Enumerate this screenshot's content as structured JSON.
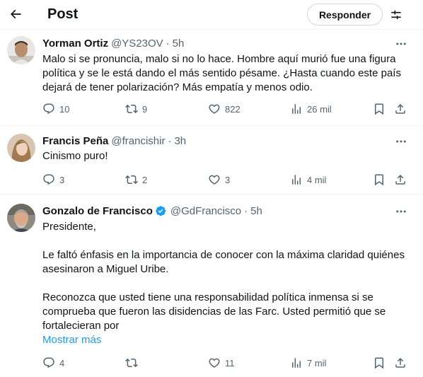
{
  "header": {
    "title": "Post",
    "reply_label": "Responder",
    "back_icon": "arrow-left-icon",
    "settings_icon": "sliders-icon"
  },
  "tweets": [
    {
      "name": "Yorman Ortiz",
      "handle": "@YS23OV",
      "sep": "·",
      "time": "5h",
      "text": "Malo si se pronuncia, malo si no lo hace. Hombre aquí murió fue una figura política y se le está dando el más sentido pésame. ¿Hasta cuando este país dejará de tener polarización? Más empatía y menos odio.",
      "replies": "10",
      "reposts": "9",
      "likes": "822",
      "views": "26 mil"
    },
    {
      "name": "Francis Peña",
      "handle": "@francishir",
      "sep": "·",
      "time": "3h",
      "text": "Cinismo puro!",
      "replies": "3",
      "reposts": "2",
      "likes": "3",
      "views": "4 mil"
    },
    {
      "name": "Gonzalo de Francisco",
      "handle": "@GdFrancisco",
      "sep": "·",
      "time": "5h",
      "verified": true,
      "paragraphs": [
        "Presidente,",
        "Le faltó énfasis en la importancia de conocer con la máxima claridad quiénes asesinaron a Miguel Uribe.",
        "Reconozca que usted tiene una responsabilidad política inmensa si se comprueba que fueron las disidencias de las Farc. Usted permitió que se fortalecieran por"
      ],
      "show_more": "Mostrar más",
      "replies": "4",
      "reposts": "",
      "likes": "11",
      "views": "7 mil"
    }
  ],
  "colors": {
    "text": "#0f1419",
    "muted": "#536471",
    "link": "#1d9bf0",
    "border": "#eff3f4",
    "verified": "#1d9bf0"
  }
}
